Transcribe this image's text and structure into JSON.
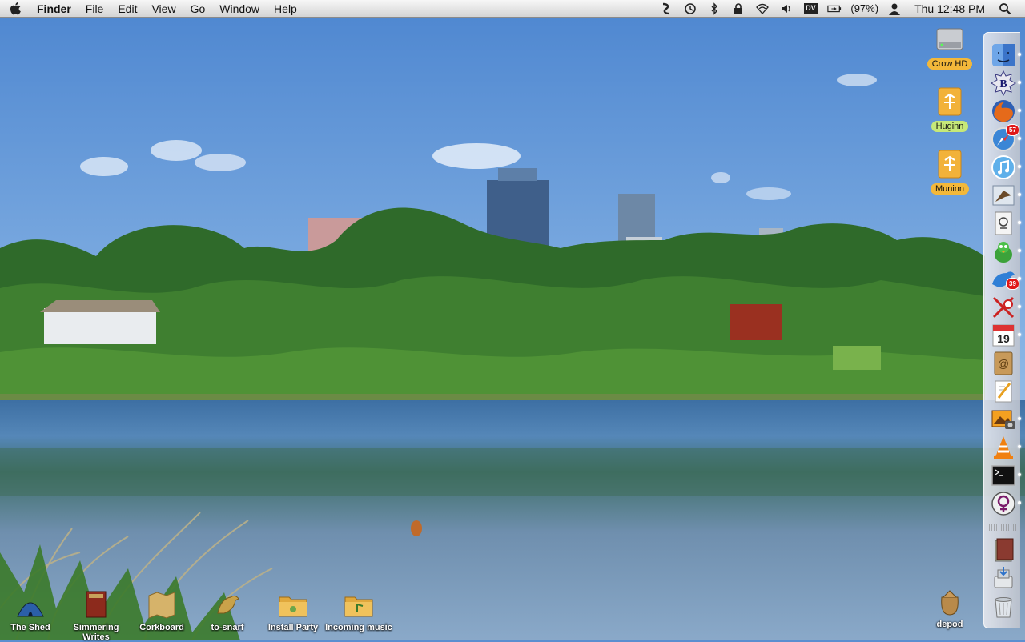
{
  "menubar": {
    "app_name": "Finder",
    "menus": [
      "File",
      "Edit",
      "View",
      "Go",
      "Window",
      "Help"
    ],
    "extras": [
      "script-icon",
      "time-machine-icon",
      "bluetooth-icon",
      "lock-icon",
      "wifi-icon",
      "volume-icon"
    ],
    "dv_label": "DV",
    "battery_percent": "(97%)",
    "clock": "Thu 12:48 PM"
  },
  "desktop_right": [
    {
      "label": "Crow HD",
      "icon": "hard-drive-icon",
      "style": "orange"
    },
    {
      "label": "Huginn",
      "icon": "firewire-drive-icon",
      "style": "green"
    },
    {
      "label": "Muninn",
      "icon": "firewire-drive-icon",
      "style": "orange"
    }
  ],
  "desktop_bottom": [
    {
      "label": "The Shed",
      "icon": "tent-icon"
    },
    {
      "label": "Simmering Writes",
      "icon": "book-icon"
    },
    {
      "label": "Corkboard",
      "icon": "map-icon"
    },
    {
      "label": "to-snarf",
      "icon": "bird-icon"
    },
    {
      "label": "Install Party",
      "icon": "folder-icon"
    },
    {
      "label": "Incoming music",
      "icon": "folder-icon"
    },
    {
      "label": "depod",
      "icon": "sack-icon"
    }
  ],
  "dock": {
    "items": [
      {
        "name": "finder",
        "running": true
      },
      {
        "name": "bbedit",
        "running": true
      },
      {
        "name": "firefox",
        "running": true
      },
      {
        "name": "safari",
        "running": true,
        "badge": "57"
      },
      {
        "name": "itunes",
        "running": true
      },
      {
        "name": "mail-hawk",
        "running": true
      },
      {
        "name": "preview",
        "running": true
      },
      {
        "name": "adium",
        "running": true
      },
      {
        "name": "twitterrific",
        "running": true,
        "badge": "39"
      },
      {
        "name": "tools",
        "running": true
      },
      {
        "name": "ical",
        "running": true,
        "date": "19"
      },
      {
        "name": "address-book",
        "running": false
      },
      {
        "name": "textedit",
        "running": false
      },
      {
        "name": "iphoto",
        "running": true
      },
      {
        "name": "vlc",
        "running": true
      },
      {
        "name": "terminal",
        "running": true
      },
      {
        "name": "perian",
        "running": true
      },
      {
        "name": "documents-stack",
        "running": false
      },
      {
        "name": "downloads-stack",
        "running": false
      },
      {
        "name": "trash",
        "running": false
      }
    ]
  }
}
